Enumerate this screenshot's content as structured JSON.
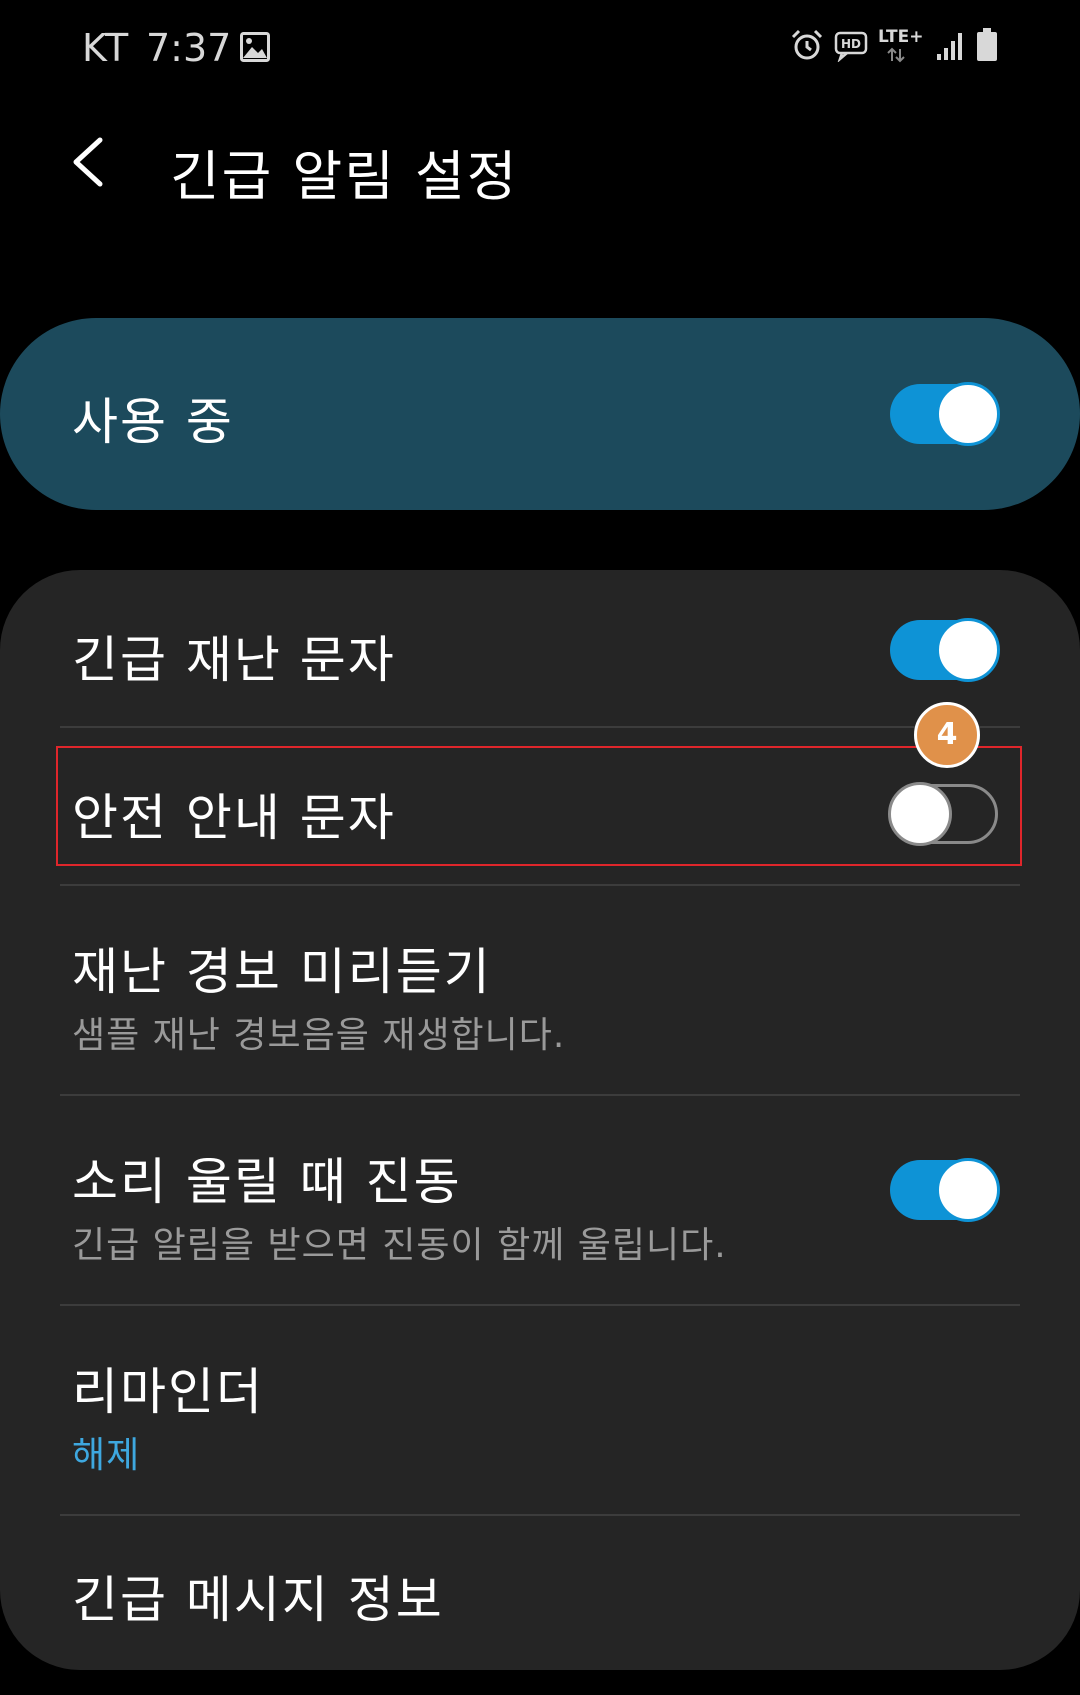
{
  "status_bar": {
    "carrier": "KT",
    "time": "7:37",
    "icons": [
      "image-icon",
      "alarm-icon",
      "hd-voice-icon",
      "lte-plus-icon",
      "signal-icon",
      "battery-icon"
    ],
    "lte_label": "LTE+",
    "hd_label": "HD"
  },
  "header": {
    "title": "긴급 알림 설정",
    "back_icon": "chevron-left-icon"
  },
  "master_toggle": {
    "label": "사용 중",
    "on": true
  },
  "settings": [
    {
      "title": "긴급 재난 문자",
      "toggle": true
    },
    {
      "title": "안전 안내 문자",
      "toggle": false,
      "badge": "4"
    },
    {
      "title": "재난 경보 미리듣기",
      "subtitle": "샘플 재난 경보음을 재생합니다."
    },
    {
      "title": "소리 울릴 때 진동",
      "subtitle": "긴급 알림을 받으면 진동이 함께 울립니다.",
      "toggle": true
    },
    {
      "title": "리마인더",
      "subtitle": "해제"
    },
    {
      "title": "긴급 메시지 정보"
    }
  ],
  "colors": {
    "background": "#000000",
    "master_card": "#1c4a5c",
    "list_card": "#252525",
    "accent": "#0e93d6",
    "link": "#3ea8e0",
    "highlight": "#e0262b",
    "badge": "#e0914a"
  }
}
